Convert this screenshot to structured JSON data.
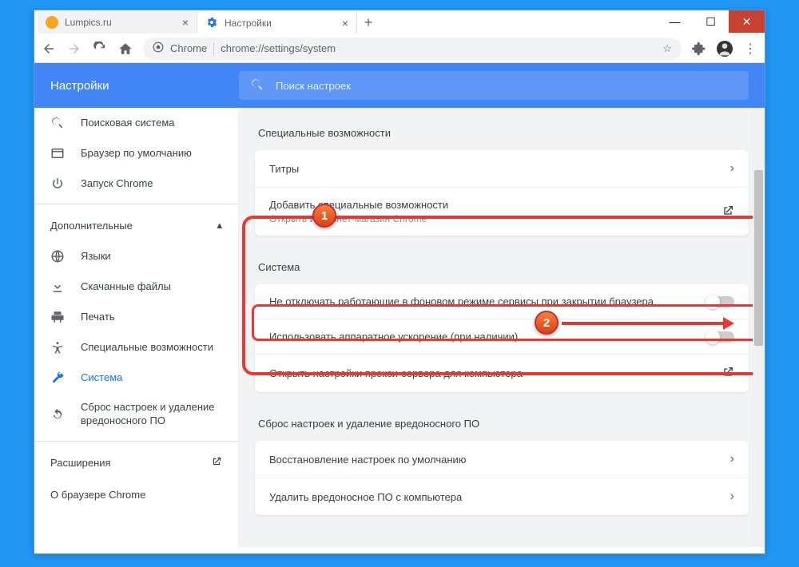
{
  "tabs": [
    {
      "title": "Lumpics.ru",
      "favicon_color": "#f5a623",
      "active": false
    },
    {
      "title": "Настройки",
      "favicon_color": "#1a73e8",
      "active": true
    }
  ],
  "omnibox": {
    "scheme_label": "Chrome",
    "url": "chrome://settings/system"
  },
  "header": {
    "title": "Настройки",
    "search_placeholder": "Поиск настроек"
  },
  "sidebar": {
    "items_top": [
      {
        "icon": "search",
        "label": "Поисковая система"
      },
      {
        "icon": "browser",
        "label": "Браузер по умолчанию"
      },
      {
        "icon": "power",
        "label": "Запуск Chrome"
      }
    ],
    "advanced_label": "Дополнительные",
    "items_adv": [
      {
        "icon": "globe",
        "label": "Языки"
      },
      {
        "icon": "download",
        "label": "Скачанные файлы"
      },
      {
        "icon": "print",
        "label": "Печать"
      },
      {
        "icon": "a11y",
        "label": "Специальные возможности"
      },
      {
        "icon": "wrench",
        "label": "Система",
        "active": true
      },
      {
        "icon": "reset",
        "label": "Сброс настроек и удаление вредоносного ПО"
      }
    ],
    "extensions_label": "Расширения",
    "about_label": "О браузере Chrome"
  },
  "sections": {
    "a11y": {
      "title": "Специальные возможности",
      "rows": [
        {
          "label": "Титры",
          "action": "chevron"
        },
        {
          "label": "Добавить специальные возможности",
          "sub": "Открыть Интернет-магазин Chrome",
          "action": "extlink"
        }
      ]
    },
    "system": {
      "title": "Система",
      "rows": [
        {
          "label": "Не отключать работающие в фоновом режиме сервисы при закрытии браузера",
          "action": "toggle"
        },
        {
          "label": "Использовать аппаратное ускорение (при наличии)",
          "action": "toggle"
        },
        {
          "label": "Открыть настройки прокси-сервера для компьютера",
          "action": "extlink"
        }
      ]
    },
    "reset": {
      "title": "Сброс настроек и удаление вредоносного ПО",
      "rows": [
        {
          "label": "Восстановление настроек по умолчанию",
          "action": "chevron"
        },
        {
          "label": "Удалить вредоносное ПО с компьютера",
          "action": "chevron"
        }
      ]
    }
  },
  "callouts": {
    "one": "1",
    "two": "2"
  }
}
